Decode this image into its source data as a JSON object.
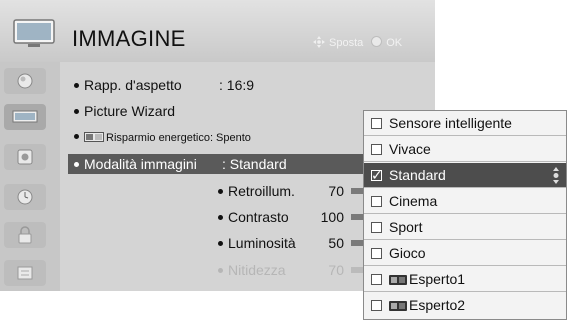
{
  "header": {
    "title": "IMMAGINE",
    "hint_move": "Sposta",
    "hint_ok": "OK"
  },
  "sidebar": {
    "items": [
      {
        "icon": "picture-icon"
      },
      {
        "icon": "tv-icon",
        "active": true
      },
      {
        "icon": "speaker-icon"
      },
      {
        "icon": "clock-icon"
      },
      {
        "icon": "lock-icon"
      },
      {
        "icon": "options-icon"
      }
    ]
  },
  "menu": {
    "aspect_label": "Rapp. d'aspetto",
    "aspect_value": ": 16:9",
    "wizard_label": "Picture Wizard",
    "energy_label": "Risparmio energetico",
    "energy_value": ": Spento",
    "mode_label": "Modalità immagini",
    "mode_value": ": Standard",
    "settings": [
      {
        "label": "Retroillum.",
        "value": "70"
      },
      {
        "label": "Contrasto",
        "value": "100"
      },
      {
        "label": "Luminosità",
        "value": "50"
      },
      {
        "label": "Nitidezza",
        "value": "70"
      }
    ]
  },
  "dropdown": {
    "options": [
      {
        "label": "Sensore intelligente",
        "checked": false
      },
      {
        "label": "Vivace",
        "checked": false
      },
      {
        "label": "Standard",
        "checked": true
      },
      {
        "label": "Cinema",
        "checked": false
      },
      {
        "label": "Sport",
        "checked": false
      },
      {
        "label": "Gioco",
        "checked": false
      },
      {
        "label": "Esperto1",
        "checked": false,
        "badge": true
      },
      {
        "label": "Esperto2",
        "checked": false,
        "badge": true
      }
    ]
  }
}
